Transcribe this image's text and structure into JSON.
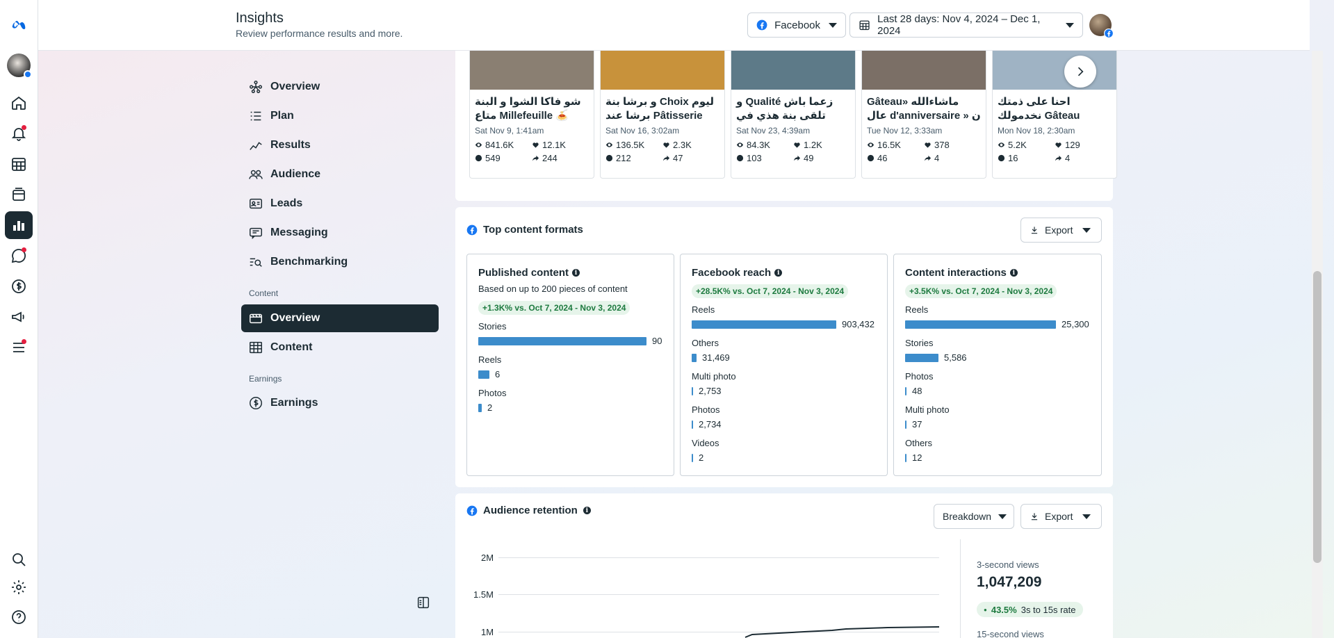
{
  "header": {
    "title": "Insights",
    "subtitle": "Review performance results and more.",
    "platform": "Facebook",
    "date_range": "Last 28 days: Nov 4, 2024 – Dec 1, 2024"
  },
  "sidebar": {
    "items": [
      {
        "label": "Overview",
        "icon": "network-icon"
      },
      {
        "label": "Plan",
        "icon": "list-icon"
      },
      {
        "label": "Results",
        "icon": "trend-icon"
      },
      {
        "label": "Audience",
        "icon": "people-icon"
      },
      {
        "label": "Leads",
        "icon": "id-card-icon"
      },
      {
        "label": "Messaging",
        "icon": "chat-icon"
      },
      {
        "label": "Benchmarking",
        "icon": "magnify-icon"
      }
    ],
    "content_section": "Content",
    "content_items": [
      {
        "label": "Overview",
        "icon": "film-icon"
      },
      {
        "label": "Content",
        "icon": "table-icon"
      }
    ],
    "earnings_section": "Earnings",
    "earnings_items": [
      {
        "label": "Earnings",
        "icon": "dollar-icon"
      }
    ]
  },
  "posts": [
    {
      "title": "شو فاكا الشوا و البنة متاع Millefeuille 🍝 عند…",
      "date": "Sat Nov 9, 1:41am",
      "views": "841.6K",
      "likes": "12.1K",
      "comments": "549",
      "shares": "244",
      "color": "#8a7f72"
    },
    {
      "title": "و برشا بنة Choix ليوم برشا عند Pâtisserie Mahdi…",
      "date": "Sat Nov 16, 3:02am",
      "views": "136.5K",
      "likes": "2.3K",
      "comments": "212",
      "shares": "47",
      "color": "#c8923b"
    },
    {
      "title": "و Qualité زعما باش تلقى بنة هذي في بلاصة اخرى…",
      "date": "Sat Nov 23, 4:39am",
      "views": "84.3K",
      "likes": "1.2K",
      "comments": "103",
      "shares": "49",
      "color": "#5d7a88"
    },
    {
      "title": "Gâteau» ماشاءالله عال d'anniversaire » ن عند…",
      "date": "Tue Nov 12, 3:33am",
      "views": "16.5K",
      "likes": "378",
      "comments": "46",
      "shares": "4",
      "color": "#7b6f66"
    },
    {
      "title": "احنا على ذمتك نخدمولك Gâteau للفرحة خبزة",
      "date": "Mon Nov 18, 2:30am",
      "views": "5.2K",
      "likes": "129",
      "comments": "16",
      "shares": "4",
      "color": "#9fb3c4"
    }
  ],
  "formats": {
    "title": "Top content formats",
    "export": "Export",
    "published": {
      "title": "Published content",
      "desc": "Based on up to 200 pieces of content",
      "change": "+1.3K% vs. Oct 7, 2024 - Nov 3, 2024",
      "rows": [
        {
          "label": "Stories",
          "value": "90",
          "frac": 1.0
        },
        {
          "label": "Reels",
          "value": "6",
          "frac": 0.067
        },
        {
          "label": "Photos",
          "value": "2",
          "frac": 0.022
        }
      ]
    },
    "reach": {
      "title": "Facebook reach",
      "change": "+28.5K% vs. Oct 7, 2024 - Nov 3, 2024",
      "rows": [
        {
          "label": "Reels",
          "value": "903,432",
          "frac": 1.0
        },
        {
          "label": "Others",
          "value": "31,469",
          "frac": 0.035
        },
        {
          "label": "Multi photo",
          "value": "2,753",
          "frac": 0.003
        },
        {
          "label": "Photos",
          "value": "2,734",
          "frac": 0.003
        },
        {
          "label": "Videos",
          "value": "2",
          "frac": 0.0
        }
      ]
    },
    "interactions": {
      "title": "Content interactions",
      "change": "+3.5K% vs. Oct 7, 2024 - Nov 3, 2024",
      "rows": [
        {
          "label": "Reels",
          "value": "25,300",
          "frac": 1.0
        },
        {
          "label": "Stories",
          "value": "5,586",
          "frac": 0.221
        },
        {
          "label": "Photos",
          "value": "48",
          "frac": 0.002
        },
        {
          "label": "Multi photo",
          "value": "37",
          "frac": 0.0015
        },
        {
          "label": "Others",
          "value": "12",
          "frac": 0.0005
        }
      ]
    }
  },
  "retention": {
    "title": "Audience retention",
    "breakdown": "Breakdown",
    "export": "Export",
    "y_ticks": [
      "2M",
      "1.5M",
      "1M"
    ],
    "metric_label": "3-second views",
    "metric_value": "1,047,209",
    "rate_value": "43.5%",
    "rate_label": "3s to 15s rate",
    "next_label": "15-second views"
  },
  "colors": {
    "accent": "#1877f2",
    "bar": "#3c8ccb",
    "positive": "#1d7a3f"
  }
}
